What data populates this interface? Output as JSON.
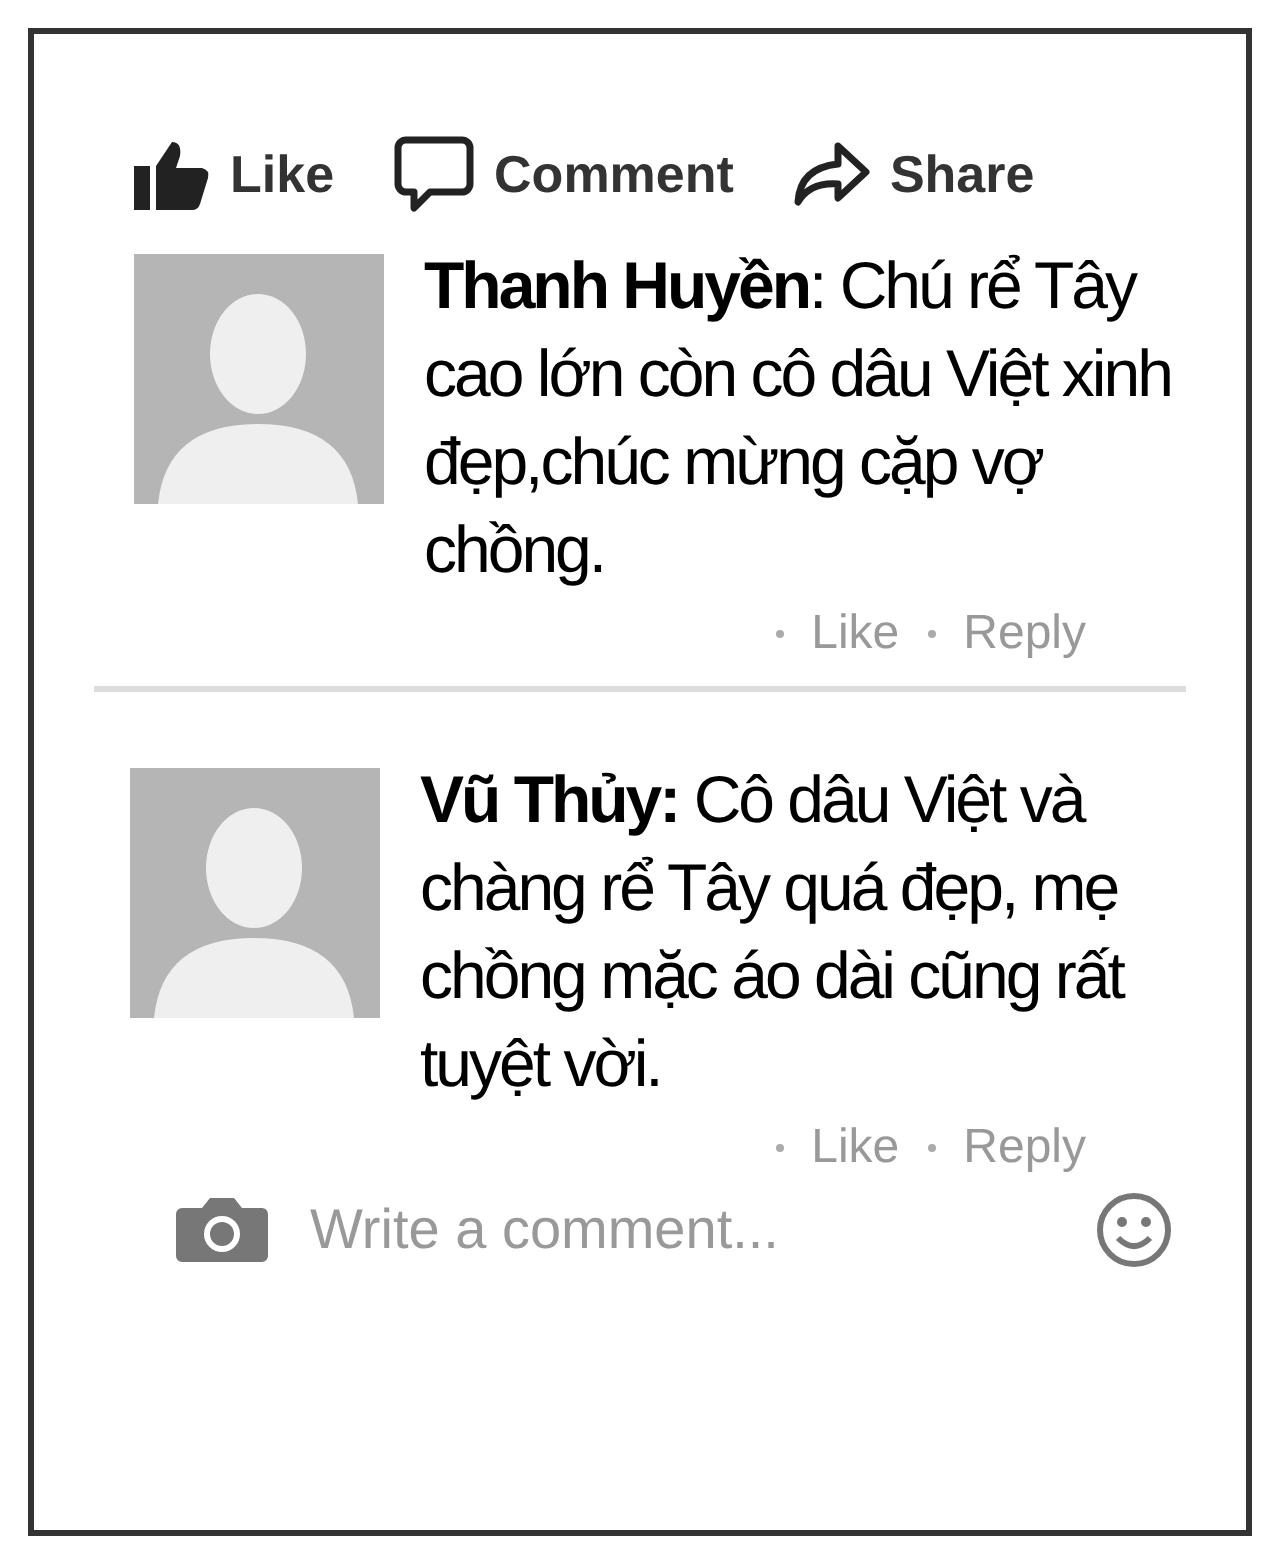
{
  "actions": [
    {
      "kind": "like",
      "label": "Like"
    },
    {
      "kind": "comment",
      "label": "Comment"
    },
    {
      "kind": "share",
      "label": "Share"
    }
  ],
  "comments": [
    {
      "text": "**Thanh Huyền**: Chú rể Tây cao lớn còn cô dâu Việt xinh đẹp,chúc mừng cặp vợ chồng.",
      "like": "Like",
      "reply": "Reply"
    },
    {
      "text": "**Vũ Thủy:** Cô dâu Việt và chàng rể Tây quá đẹp, mẹ chồng mặc áo dài cũng rất tuyệt vời.",
      "like": "Like",
      "reply": "Reply"
    }
  ],
  "composer": {
    "placeholder": "Write a comment..."
  }
}
